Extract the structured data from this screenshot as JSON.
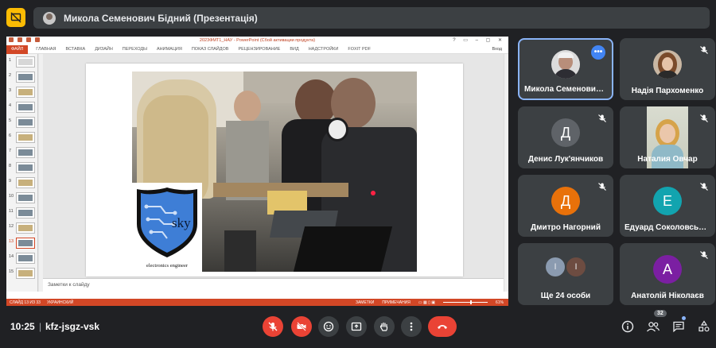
{
  "presentation": {
    "title": "Микола Семенович Бідний (Презентація)"
  },
  "powerpoint": {
    "window_title": "2023ФМТ1_НАУ - PowerPoint (Сбой активации продукта)",
    "tabs": [
      "ФАЙЛ",
      "ГЛАВНАЯ",
      "ВСТАВКА",
      "ДИЗАЙН",
      "ПЕРЕХОДЫ",
      "АНИМАЦИЯ",
      "ПОКАЗ СЛАЙДОВ",
      "РЕЦЕНЗИРОВАНИЕ",
      "ВИД",
      "НАДСТРОЙКИ",
      "FOXIT PDF"
    ],
    "login": "Вход",
    "slide_numbers": [
      "1",
      "2",
      "3",
      "4",
      "5",
      "6",
      "7",
      "8",
      "9",
      "10",
      "11",
      "12",
      "13",
      "14",
      "15"
    ],
    "active_slide": "13",
    "notes_placeholder": "Заметки к слайду",
    "status_slide": "СЛАЙД 13 ИЗ 33",
    "status_lang": "УКРАИНСКИЙ",
    "status_notes": "ЗАМЕТКИ",
    "status_comments": "ПРИМЕЧАНИЯ",
    "zoom": "61%",
    "logo_text": "sky",
    "logo_caption": "electronics engineer"
  },
  "participants": [
    {
      "name": "Микола Семенович…",
      "type": "photo",
      "active": true
    },
    {
      "name": "Надія Пархоменко",
      "type": "photo",
      "muted": true
    },
    {
      "name": "Денис Лук'янчиков",
      "initial": "Д",
      "color": "#5f6368",
      "muted": true
    },
    {
      "name": "Наталия Овчар",
      "type": "video",
      "muted": true
    },
    {
      "name": "Дмитро Нагорний",
      "initial": "Д",
      "color": "#e8710a",
      "muted": true
    },
    {
      "name": "Едуард Соколовськ…",
      "initial": "Е",
      "color": "#12a4af",
      "muted": true
    },
    {
      "name": "Ще 24 особи",
      "initials": [
        "І",
        "І"
      ],
      "colors": [
        "#8b9bb0",
        "#6d4c41"
      ]
    },
    {
      "name": "Анатолій Ніколаєв",
      "initial": "А",
      "color": "#7b1fa2",
      "muted": true
    }
  ],
  "bottom": {
    "time": "10:25",
    "separator": "|",
    "meeting_code": "kfz-jsgz-vsk",
    "people_count": "32"
  },
  "colors": {
    "accent": "#8ab4f8",
    "red": "#ea4335",
    "ppt": "#d24726"
  }
}
